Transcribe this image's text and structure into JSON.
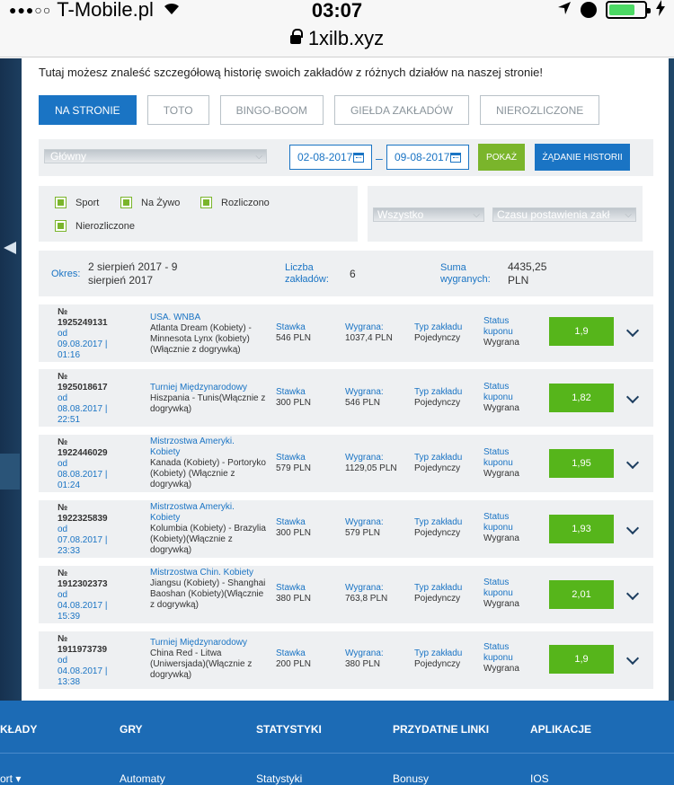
{
  "status_bar": {
    "signal": "●●●○○",
    "carrier": "T-Mobile.pl",
    "time": "03:07"
  },
  "url_bar": {
    "url": "1xilb.xyz"
  },
  "intro": "Tutaj możesz znaleść szczegółową historię swoich zakładów z różnych działów na naszej stronie!",
  "tabs": [
    {
      "label": "NA STRONIE",
      "active": true
    },
    {
      "label": "TOTO",
      "active": false
    },
    {
      "label": "BINGO-BOOM",
      "active": false
    },
    {
      "label": "GIEŁDA ZAKŁADÓW",
      "active": false
    },
    {
      "label": "NIEROZLICZONE",
      "active": false
    }
  ],
  "filters": {
    "main_select": "Główny",
    "date_from": "02-08-2017",
    "date_to": "09-08-2017",
    "dash": "–",
    "show_button": "POKAŻ",
    "history_button": "ŻĄDANIE HISTORII"
  },
  "checkboxes": [
    "Sport",
    "Na Żywo",
    "Rozliczono",
    "Nierozliczone"
  ],
  "selects": {
    "type": "Wszystko",
    "sort": "Czasu postawienia zakł"
  },
  "summary": {
    "period_label": "Okres:",
    "period_line1": "2 sierpień 2017 - 9",
    "period_line2": "sierpień 2017",
    "count_label_1": "Liczba",
    "count_label_2": "zakładów:",
    "count_value": "6",
    "sum_label_1": "Suma",
    "sum_label_2": "wygranych:",
    "sum_line1": "4435,25",
    "sum_line2": "PLN"
  },
  "bet_labels": {
    "no": "№",
    "from": "od",
    "stake": "Stawka",
    "win": "Wygrana:",
    "type": "Typ zakładu",
    "status_1": "Status",
    "status_2": "kuponu"
  },
  "bets": [
    {
      "number": "1925249131",
      "date": "09.08.2017 |",
      "time": "01:16",
      "tournament": "USA. WNBA",
      "match": "Atlanta Dream (Kobiety) - Minnesota Lynx (kobiety) (Włącznie z dogrywką)",
      "stake": "546 PLN",
      "win": "1037,4 PLN",
      "type": "Pojedynczy",
      "status": "Wygrana",
      "odds": "1,9"
    },
    {
      "number": "1925018617",
      "date": "08.08.2017 |",
      "time": "22:51",
      "tournament": "Turniej Międzynarodowy",
      "match": "Hiszpania - Tunis(Włącznie z dogrywką)",
      "stake": "300 PLN",
      "win": "546 PLN",
      "type": "Pojedynczy",
      "status": "Wygrana",
      "odds": "1,82"
    },
    {
      "number": "1922446029",
      "date": "08.08.2017 |",
      "time": "01:24",
      "tournament": "Mistrzostwa Ameryki. Kobiety",
      "match": "Kanada (Kobiety) - Portoryko (Kobiety) (Włącznie z dogrywką)",
      "stake": "579 PLN",
      "win": "1129,05 PLN",
      "type": "Pojedynczy",
      "status": "Wygrana",
      "odds": "1,95"
    },
    {
      "number": "1922325839",
      "date": "07.08.2017 |",
      "time": "23:33",
      "tournament": "Mistrzostwa Ameryki. Kobiety",
      "match": "Kolumbia (Kobiety) - Brazylia (Kobiety)(Włącznie z dogrywką)",
      "stake": "300 PLN",
      "win": "579 PLN",
      "type": "Pojedynczy",
      "status": "Wygrana",
      "odds": "1,93"
    },
    {
      "number": "1912302373",
      "date": "04.08.2017 |",
      "time": "15:39",
      "tournament": "Mistrzostwa Chin. Kobiety",
      "match": "Jiangsu (Kobiety) - Shanghai Baoshan (Kobiety)(Włącznie z dogrywką)",
      "stake": "380 PLN",
      "win": "763,8 PLN",
      "type": "Pojedynczy",
      "status": "Wygrana",
      "odds": "2,01"
    },
    {
      "number": "1911973739",
      "date": "04.08.2017 |",
      "time": "13:38",
      "tournament": "Turniej Międzynarodowy",
      "match": "China Red - Litwa (Uniwersjada)(Włącznie z dogrywką)",
      "stake": "200 PLN",
      "win": "380 PLN",
      "type": "Pojedynczy",
      "status": "Wygrana",
      "odds": "1,9"
    }
  ],
  "footer": {
    "headings": [
      "KŁADY",
      "GRY",
      "STATYSTYKI",
      "PRZYDATNE LINKI",
      "APLIKACJE"
    ],
    "sub": [
      "ort ▾",
      "Automaty",
      "Statystyki",
      "Bonusy",
      "IOS"
    ]
  }
}
